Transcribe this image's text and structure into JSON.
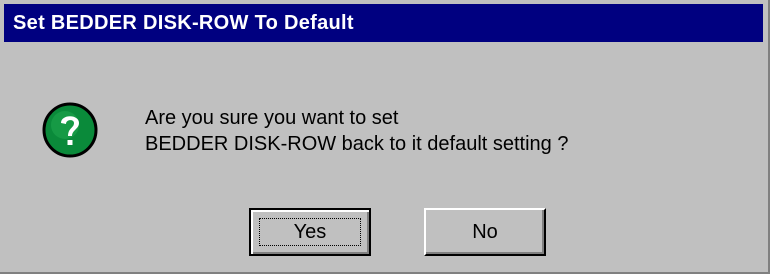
{
  "dialog": {
    "title": "Set BEDDER DISK-ROW To Default",
    "icon": "question-icon",
    "message_line1": "Are you sure you want to set",
    "message_line2": "BEDDER DISK-ROW back to it default setting ?",
    "buttons": {
      "yes": "Yes",
      "no": "No"
    },
    "default_button": "yes"
  },
  "colors": {
    "title_bar": "#000080",
    "dialog_face": "#c0c0c0",
    "icon_fill": "#0a8a3a"
  }
}
